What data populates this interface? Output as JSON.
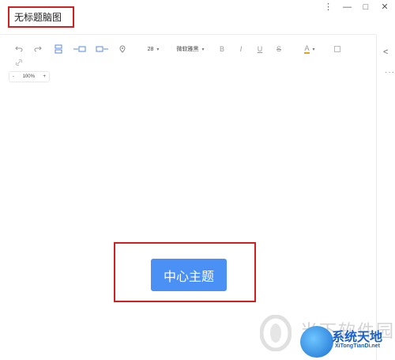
{
  "window": {
    "title": "无标题脑图",
    "controls": [
      "⋮",
      "—",
      "□",
      "✕"
    ]
  },
  "toolbar": {
    "icons": [
      "undo-icon",
      "redo-icon",
      "insert-child-icon",
      "insert-sibling-before-icon",
      "insert-sibling-after-icon",
      "location-icon"
    ],
    "font_size": "28",
    "font_family": "微软雅黑",
    "format_icons": [
      "bold-icon",
      "italic-icon",
      "underline-icon",
      "strikethrough-icon",
      "font-color-icon",
      "clear-format-icon"
    ],
    "bold_label": "B",
    "italic_label": "I",
    "underline_label": "U",
    "strike_label": "S",
    "font_color_label": "A",
    "font_color": "#e8a21a"
  },
  "zoom": {
    "minus": "-",
    "value": "100%",
    "plus": "+"
  },
  "mindmap": {
    "root_node": "中心主题",
    "node_color": "#4a90f5"
  },
  "watermark": {
    "text": "当下软件园",
    "badge_title": "系统天地",
    "badge_sub": "XiTongTianDi.net"
  },
  "side": {
    "share_icon": "<",
    "more_icon": "···"
  }
}
